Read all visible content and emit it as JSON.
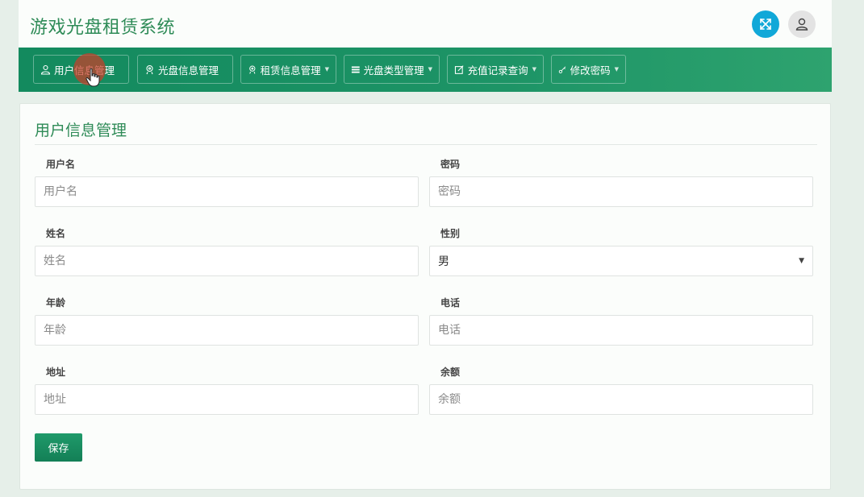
{
  "header": {
    "app_title": "游戏光盘租赁系统",
    "fullscreen_icon": "fullscreen-icon",
    "user_icon": "user-icon",
    "accent_color": "#11a8d8"
  },
  "nav": {
    "items": [
      {
        "label": "用户信息管理",
        "icon": "user-icon",
        "has_caret": false
      },
      {
        "label": "光盘信息管理",
        "icon": "disc-icon",
        "has_caret": false
      },
      {
        "label": "租赁信息管理",
        "icon": "disc-icon",
        "has_caret": true
      },
      {
        "label": "光盘类型管理",
        "icon": "list-icon",
        "has_caret": true
      },
      {
        "label": "充值记录查询",
        "icon": "edit-icon",
        "has_caret": true
      },
      {
        "label": "修改密码",
        "icon": "key-icon",
        "has_caret": true
      }
    ],
    "bar_color": "#1a9163"
  },
  "form": {
    "title": "用户信息管理",
    "fields": {
      "username": {
        "label": "用户名",
        "placeholder": "用户名"
      },
      "password": {
        "label": "密码",
        "placeholder": "密码"
      },
      "name": {
        "label": "姓名",
        "placeholder": "姓名"
      },
      "gender": {
        "label": "性别",
        "value": "男"
      },
      "age": {
        "label": "年龄",
        "placeholder": "年龄"
      },
      "phone": {
        "label": "电话",
        "placeholder": "电话"
      },
      "address": {
        "label": "地址",
        "placeholder": "地址"
      },
      "balance": {
        "label": "余额",
        "placeholder": "余额"
      }
    },
    "save_label": "保存"
  }
}
